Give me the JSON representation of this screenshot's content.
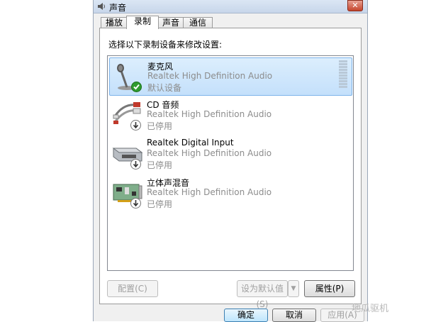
{
  "window": {
    "title": "声音",
    "close_label": "✕"
  },
  "tabs": [
    {
      "label": "播放",
      "active": false
    },
    {
      "label": "录制",
      "active": true
    },
    {
      "label": "声音",
      "active": false
    },
    {
      "label": "通信",
      "active": false
    }
  ],
  "instruction": "选择以下录制设备来修改设置:",
  "devices": [
    {
      "name": "麦克风",
      "driver": "Realtek High Definition Audio",
      "status": "默认设备",
      "icon": "microphone-icon",
      "badge": "check-badge",
      "selected": true
    },
    {
      "name": "CD 音频",
      "driver": "Realtek High Definition Audio",
      "status": "已停用",
      "icon": "cd-audio-cable-icon",
      "badge": "disabled-badge",
      "selected": false
    },
    {
      "name": "Realtek Digital Input",
      "driver": "Realtek High Definition Audio",
      "status": "已停用",
      "icon": "digital-input-icon",
      "badge": "disabled-badge",
      "selected": false
    },
    {
      "name": "立体声混音",
      "driver": "Realtek High Definition Audio",
      "status": "已停用",
      "icon": "sound-card-icon",
      "badge": "disabled-badge",
      "selected": false
    }
  ],
  "buttons": {
    "configure": "配置(C)",
    "set_default": "设为默认值(S)",
    "set_default_arrow": "▼",
    "properties": "属性(P)",
    "ok": "确定",
    "cancel": "取消",
    "apply": "应用(A)"
  },
  "watermark": "地瓜驱机",
  "colors": {
    "selection": "#c4e0fb",
    "accent": "#3c7fb1"
  }
}
